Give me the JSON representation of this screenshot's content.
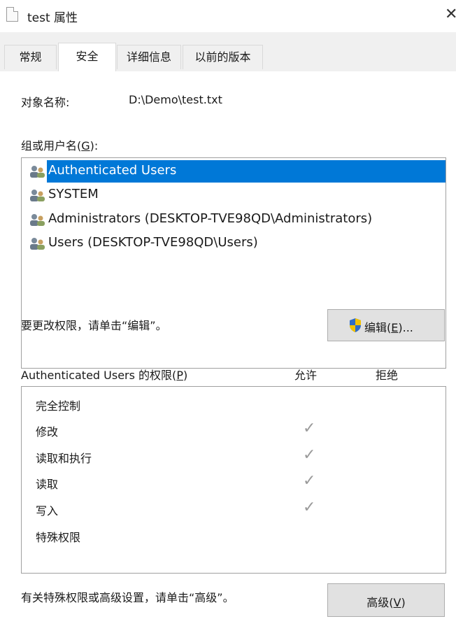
{
  "window": {
    "title": "test 属性"
  },
  "tabs": [
    {
      "label": "常规",
      "active": false
    },
    {
      "label": "安全",
      "active": true
    },
    {
      "label": "详细信息",
      "active": false
    },
    {
      "label": "以前的版本",
      "active": false
    }
  ],
  "object": {
    "label": "对象名称:",
    "value": "D:\\Demo\\test.txt"
  },
  "groups": {
    "label": "组或用户名(G):",
    "items": [
      {
        "name": "Authenticated Users",
        "selected": true
      },
      {
        "name": "SYSTEM",
        "selected": false
      },
      {
        "name": "Administrators (DESKTOP-TVE98QD\\Administrators)",
        "selected": false
      },
      {
        "name": "Users (DESKTOP-TVE98QD\\Users)",
        "selected": false
      }
    ]
  },
  "change_hint": "要更改权限，请单击“编辑”。",
  "edit_button": {
    "label": "编辑(E)...",
    "icon": "uac-shield-icon"
  },
  "permissions": {
    "label": "Authenticated Users 的权限(P)",
    "allow_header": "允许",
    "deny_header": "拒绝",
    "rows": [
      {
        "name": "完全控制",
        "allow": "",
        "deny": ""
      },
      {
        "name": "修改",
        "allow": "✓",
        "deny": ""
      },
      {
        "name": "读取和执行",
        "allow": "✓",
        "deny": ""
      },
      {
        "name": "读取",
        "allow": "✓",
        "deny": ""
      },
      {
        "name": "写入",
        "allow": "✓",
        "deny": ""
      },
      {
        "name": "特殊权限",
        "allow": "",
        "deny": ""
      }
    ]
  },
  "advanced_hint": "有关特殊权限或高级设置，请单击“高级”。",
  "advanced_button": {
    "label": "高级(V)"
  },
  "colors": {
    "selection": "#0078d7",
    "tab_bg": "#f0f0f0",
    "button_bg": "#e1e1e1"
  }
}
